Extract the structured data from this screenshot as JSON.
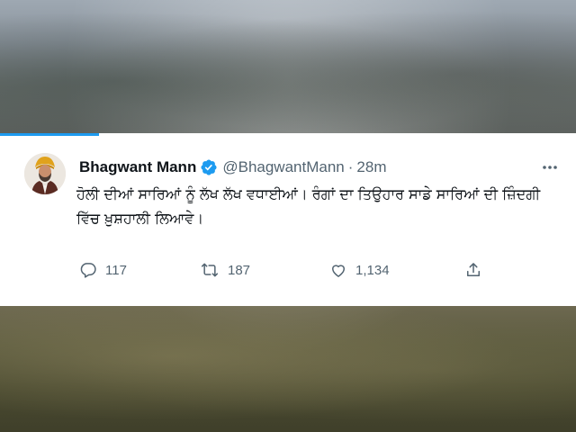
{
  "tweet": {
    "display_name": "Bhagwant Mann",
    "handle": "@BhagwantMann",
    "separator": "·",
    "time": "28m",
    "text": "ਹੋਲੀ ਦੀਆਂ ਸਾਰਿਆਂ ਨੂੰ ਲੱਖ ਲੱਖ ਵਧਾਈਆਂ। ਰੰਗਾਂ ਦਾ ਤਿਉਹਾਰ ਸਾਡੇ ਸਾਰਿਆਂ ਦੀ ਜ਼ਿੰਦਗੀ ਵਿੱਚ ਖ਼ੁਸ਼ਹਾਲੀ ਲਿਆਵੇ।",
    "verified": true,
    "actions": {
      "reply_count": "117",
      "retweet_count": "187",
      "like_count": "1,134"
    }
  },
  "icons": {
    "verified": "verified-badge-icon",
    "more": "more-horizontal-icon",
    "reply": "reply-bubble-icon",
    "retweet": "retweet-icon",
    "like": "heart-icon",
    "share": "share-icon"
  },
  "colors": {
    "accent": "#1d9bf0",
    "text_primary": "#0f1419",
    "text_secondary": "#536471",
    "card_background": "#ffffff"
  }
}
